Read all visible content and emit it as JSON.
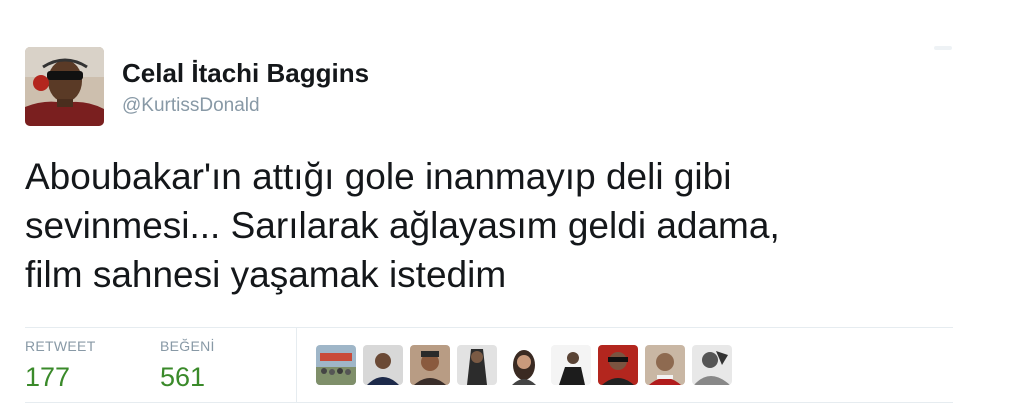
{
  "author": {
    "display_name": "Celal İtachi Baggins",
    "handle": "@KurtissDonald",
    "avatar_icon": "profile-photo-avatar"
  },
  "tweet": {
    "lines": [
      "Aboubakar'ın attığı gole inanmayıp deli gibi",
      "sevinmesi... Sarılarak ağlayasım geldi adama,",
      "film sahnesi yaşamak istedim"
    ]
  },
  "stats": {
    "retweet_label": "RETWEET",
    "retweet_count": "177",
    "like_label": "BEĞENİ",
    "like_count": "561"
  },
  "likers": [
    {
      "icon": "liker-avatar-crowd"
    },
    {
      "icon": "liker-avatar-person"
    },
    {
      "icon": "liker-avatar-person"
    },
    {
      "icon": "liker-avatar-person"
    },
    {
      "icon": "liker-avatar-person"
    },
    {
      "icon": "liker-avatar-person"
    },
    {
      "icon": "liker-avatar-person"
    },
    {
      "icon": "liker-avatar-person"
    },
    {
      "icon": "liker-avatar-bw"
    }
  ],
  "colors": {
    "text": "#14171a",
    "secondary": "#8899a6",
    "count": "#3a8a2a",
    "divider": "#e6ecf0"
  }
}
